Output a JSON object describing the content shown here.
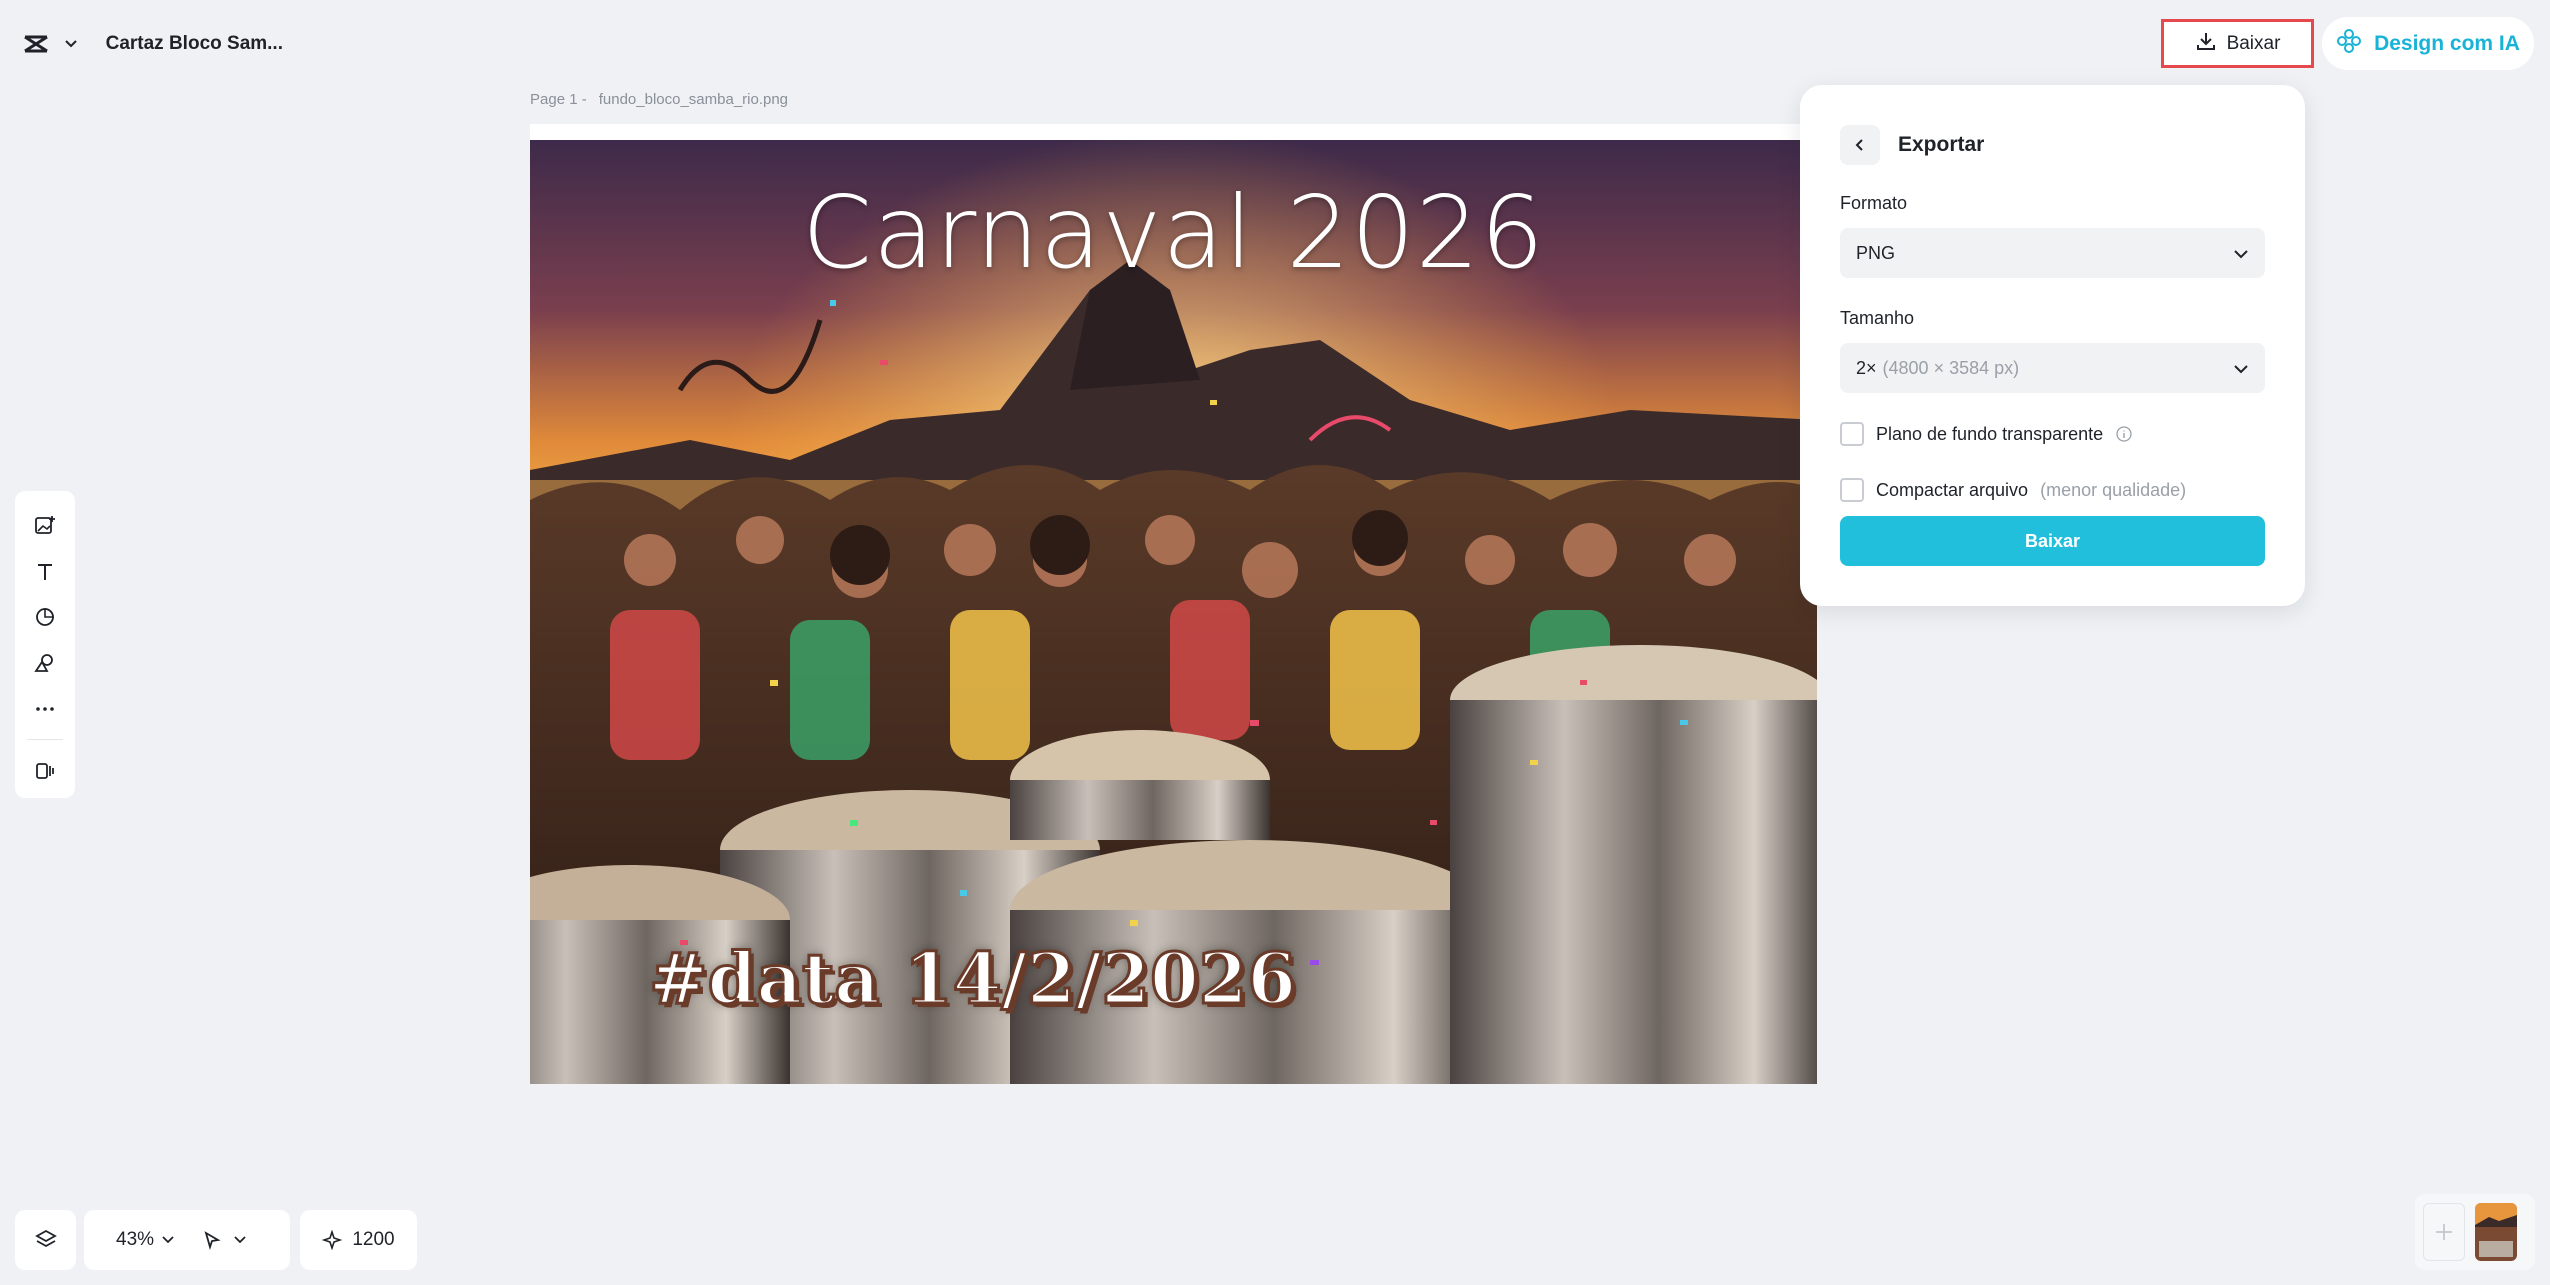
{
  "header": {
    "project_title": "Cartaz Bloco Sam...",
    "download_label": "Baixar",
    "design_ai_label": "Design com IA"
  },
  "canvas": {
    "page_label": "Page 1 -",
    "file_name": "fundo_bloco_samba_rio.png",
    "headline": "Carnaval 2026",
    "date_text": "#data 14/2/2026"
  },
  "export_panel": {
    "title": "Exportar",
    "format_label": "Formato",
    "format_value": "PNG",
    "size_label": "Tamanho",
    "size_value": "2×",
    "size_detail": "(4800 × 3584 px)",
    "transparent_label": "Plano de fundo transparente",
    "transparent_checked": false,
    "compress_label": "Compactar arquivo",
    "compress_note": "(menor qualidade)",
    "compress_checked": false,
    "download_button": "Baixar"
  },
  "left_toolbar": {
    "tools": [
      "add-image-icon",
      "text-icon",
      "shapes-icon",
      "elements-icon",
      "more-icon",
      "panel-icon"
    ]
  },
  "bottom_bar": {
    "zoom": "43%",
    "credits": "1200"
  },
  "colors": {
    "accent": "#22bfdc",
    "ai_text": "#1ab3d8",
    "highlight_border": "#e5484d",
    "background": "#eff1f4"
  }
}
